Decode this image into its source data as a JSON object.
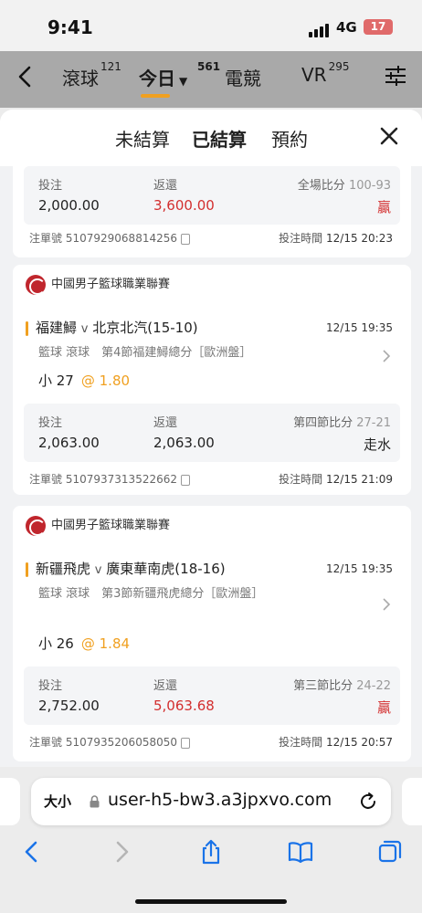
{
  "status_bar": {
    "time": "9:41",
    "network": "4G",
    "battery": "17"
  },
  "top_nav": {
    "tabs": [
      {
        "label": "滾球",
        "count": "121"
      },
      {
        "label": "今日",
        "count": "561"
      },
      {
        "label": "電競",
        "count": ""
      },
      {
        "label": "VR",
        "count": "295"
      }
    ],
    "active_tab": "今日"
  },
  "sheet": {
    "tabs": [
      "未結算",
      "已結算",
      "預約"
    ],
    "active_tab": "已結算"
  },
  "partial_bet": {
    "stake_label": "投注",
    "stake": "2,000.00",
    "return_label": "返還",
    "return": "3,600.00",
    "score_label": "全場比分",
    "score": "100-93",
    "result": "贏",
    "ticket_label": "注單號",
    "ticket": "5107929068814256",
    "time_label": "投注時間",
    "time": "12/15 20:23"
  },
  "bets": [
    {
      "league": "中國男子籃球職業聯賽",
      "home": "福建鱘",
      "vs": "v",
      "away": "北京北汽",
      "live_score": "(15-10)",
      "match_time": "12/15 19:35",
      "desc": "籃球 滾球　第4節福建鱘總分［歐洲盤］",
      "pick": "小 27",
      "odds": "@ 1.80",
      "stake_label": "投注",
      "stake": "2,063.00",
      "return_label": "返還",
      "return": "2,063.00",
      "score_label": "第四節比分",
      "score": "27-21",
      "result": "走水",
      "ticket_label": "注單號",
      "ticket": "5107937313522662",
      "time_label": "投注時間",
      "time": "12/15 21:09"
    },
    {
      "league": "中國男子籃球職業聯賽",
      "home": "新疆飛虎",
      "vs": "v",
      "away": "廣東華南虎",
      "live_score": "(18-16)",
      "match_time": "12/15 19:35",
      "desc": "籃球 滾球　第3節新疆飛虎總分［歐洲盤］",
      "pick": "小 26",
      "odds": "@ 1.84",
      "stake_label": "投注",
      "stake": "2,752.00",
      "return_label": "返還",
      "return": "5,063.68",
      "score_label": "第三節比分",
      "score": "24-22",
      "result": "贏",
      "ticket_label": "注單號",
      "ticket": "5107935206058050",
      "time_label": "投注時間",
      "time": "12/15 20:57"
    }
  ],
  "browser": {
    "text_size": "大小",
    "url": "user-h5-bw3.a3jpxvo.com"
  },
  "colors": {
    "accent": "#f0a020",
    "win_red": "#d32f2f"
  }
}
